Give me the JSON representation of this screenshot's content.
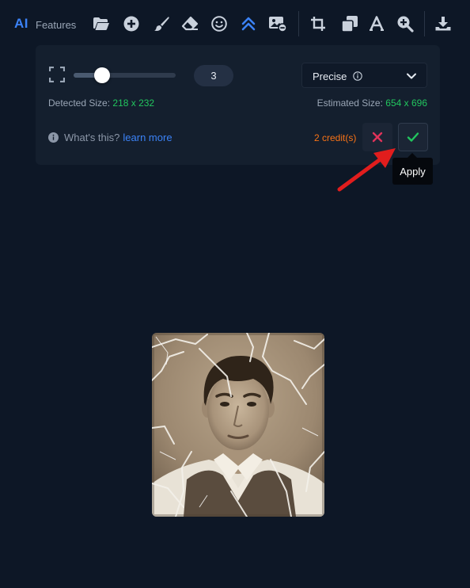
{
  "toolbar": {
    "logo": "AI",
    "features_label": "Features",
    "icons": [
      "folder-icon",
      "add-circle-icon",
      "brush-icon",
      "eraser-icon",
      "smiley-icon",
      "upscale-icon",
      "remove-bg-icon",
      "crop-icon",
      "layers-icon",
      "text-icon",
      "zoom-in-icon",
      "download-icon"
    ],
    "active_icon": "upscale-icon",
    "accent_color": "#3b82f6"
  },
  "upscale_panel": {
    "scale_value": "3",
    "slider_value_fraction": 0.28,
    "mode": {
      "selected": "Precise"
    },
    "detected_label": "Detected Size:",
    "detected_value": "218 x 232",
    "estimated_label": "Estimated Size:",
    "estimated_value": "654 x 696",
    "help_text": "What's this?",
    "help_link": "learn more",
    "credits": "2 credit(s)",
    "apply_tooltip": "Apply",
    "size_value_color": "#22c55e",
    "credits_color": "#f97316"
  }
}
